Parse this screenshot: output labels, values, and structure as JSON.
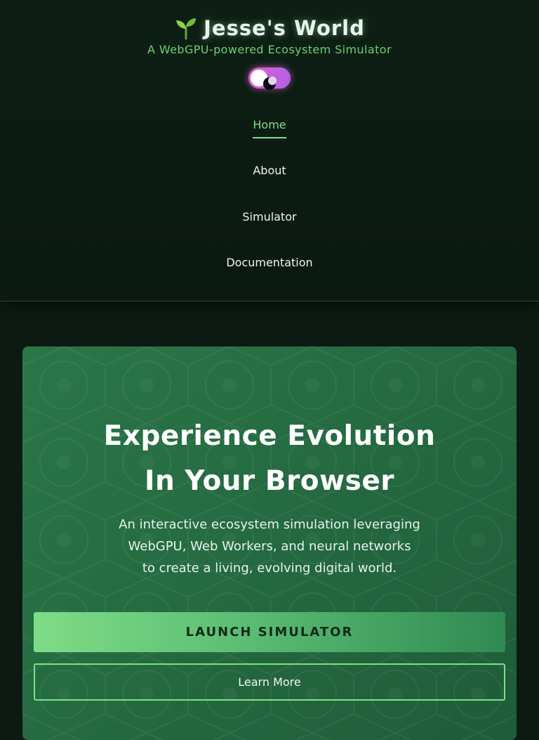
{
  "brand": {
    "icon": "sprout-icon",
    "title": "Jesse's World",
    "subtitle": "A WebGPU-powered Ecosystem Simulator"
  },
  "theme_toggle": {
    "icon": "moon-icon",
    "colors": [
      "#e060c8",
      "#b460e8"
    ]
  },
  "nav": {
    "items": [
      {
        "label": "Home",
        "active": true
      },
      {
        "label": "About",
        "active": false
      },
      {
        "label": "Simulator",
        "active": false
      },
      {
        "label": "Documentation",
        "active": false
      }
    ]
  },
  "hero": {
    "title_line1": "Experience Evolution",
    "title_line2": "In Your Browser",
    "description_line1": "An interactive ecosystem simulation leveraging",
    "description_line2": "WebGPU, Web Workers, and neural networks",
    "description_line3": "to create a living, evolving digital world.",
    "primary_button": "LAUNCH SIMULATOR",
    "secondary_button": "Learn More"
  },
  "colors": {
    "background": "#0c1a12",
    "accent": "#7ee08a",
    "hero": "#2b7649"
  }
}
